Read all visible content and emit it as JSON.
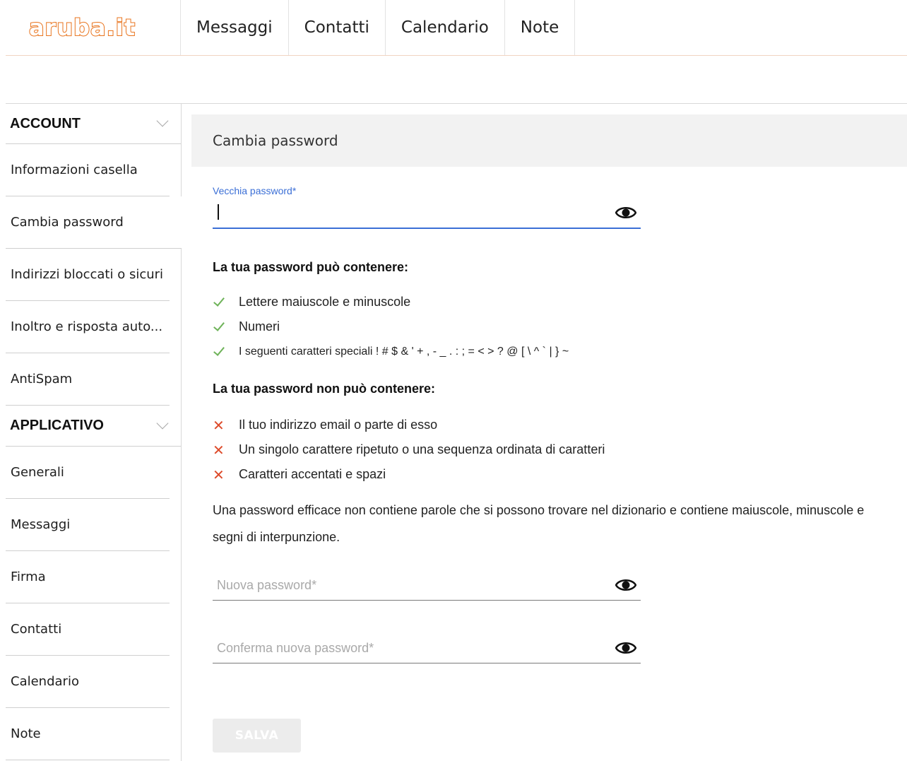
{
  "brand": {
    "logo_text": "aruba.it",
    "accent_color": "#e8731c"
  },
  "nav": {
    "tabs": [
      {
        "label": "Messaggi"
      },
      {
        "label": "Contatti"
      },
      {
        "label": "Calendario"
      },
      {
        "label": "Note"
      }
    ]
  },
  "sidebar": {
    "sections": [
      {
        "title": "ACCOUNT",
        "items": [
          {
            "label": "Informazioni casella"
          },
          {
            "label": "Cambia password"
          },
          {
            "label": "Indirizzi bloccati o sicuri"
          },
          {
            "label": "Inoltro e risposta auto..."
          },
          {
            "label": "AntiSpam"
          }
        ]
      },
      {
        "title": "APPLICATIVO",
        "items": [
          {
            "label": "Generali"
          },
          {
            "label": "Messaggi"
          },
          {
            "label": "Firma"
          },
          {
            "label": "Contatti"
          },
          {
            "label": "Calendario"
          },
          {
            "label": "Note"
          }
        ]
      }
    ]
  },
  "main": {
    "title": "Cambia password",
    "old_password": {
      "label": "Vecchia password*",
      "value": ""
    },
    "allowed_heading": "La tua password può contenere:",
    "allowed": [
      "Lettere maiuscole e minuscole",
      "Numeri",
      "I seguenti caratteri speciali ! # $ & ' + , - _ . : ; = < > ? @ [ \\ ^ ` | } ~"
    ],
    "forbidden_heading": "La tua password non può contenere:",
    "forbidden": [
      "Il tuo indirizzo email o parte di esso",
      "Un singolo carattere ripetuto o una sequenza ordinata di caratteri",
      "Caratteri accentati e spazi"
    ],
    "advice": "Una password efficace non contiene parole che si possono trovare nel dizionario e contiene maiuscole, minuscole e segni di interpunzione.",
    "new_password": {
      "placeholder": "Nuova password*",
      "value": ""
    },
    "confirm_password": {
      "placeholder": "Conferma nuova password*",
      "value": ""
    },
    "save_label": "SALVA"
  }
}
